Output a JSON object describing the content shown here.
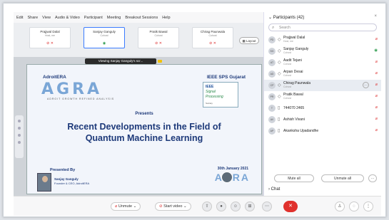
{
  "menubar": [
    "Edit",
    "Share",
    "View",
    "Audio & Video",
    "Participant",
    "Meeting",
    "Breakout Sessions",
    "Help"
  ],
  "strip": {
    "tiles": [
      {
        "name": "Prajjwal Dalal",
        "sub": "Host, me"
      },
      {
        "name": "Sanjay Ganguly",
        "sub": "Cohost"
      },
      {
        "name": "Pratik Bawal",
        "sub": "Cohost"
      },
      {
        "name": "Chirag Paunwala",
        "sub": "Cohost"
      }
    ],
    "layout_label": "Layout"
  },
  "stage": {
    "viewing": "Viewing Sanjay Ganguly's scr...",
    "slide": {
      "org_left": "AdroitERA",
      "agra": "AGRA",
      "agra_sub": "ADROIT GROWTH REFINED ANALYSIS",
      "org_right": "IEEE SPS Gujarat",
      "ieee_l1": "IEEE",
      "ieee_l2": "Signal",
      "ieee_l3": "Processing",
      "ieee_l4": "Society",
      "presents": "Presents",
      "title_line1": "Recent Developments in the Field of",
      "title_line2": "Quantum Machine Learning",
      "presented_by": "Presented By",
      "presenter_name": "Sanjay Ganguly",
      "presenter_role": "Founder & CEO, AdroitERA",
      "date": "30th January 2021",
      "agra_small": "AGRA"
    }
  },
  "panel": {
    "title": "Participants (42)",
    "search_placeholder": "Search",
    "participants": [
      {
        "initials": "PD",
        "name": "Prajjwal Dalal",
        "sub": "Host, me",
        "mic_on": false
      },
      {
        "initials": "SG",
        "name": "Sanjay Ganguly",
        "sub": "Cohost",
        "mic_on": true
      },
      {
        "initials": "AT",
        "name": "Aadit Tejani",
        "sub": "Cohost",
        "mic_on": false
      },
      {
        "initials": "AD",
        "name": "Arpan Desai",
        "sub": "Cohost",
        "mic_on": false
      },
      {
        "initials": "CP",
        "name": "Chirag Paunwala",
        "sub": "Cohost",
        "mic_on": false
      },
      {
        "initials": "PR",
        "name": "Pratik Bawal",
        "sub": "Cohost",
        "mic_on": false
      },
      {
        "initials": "T",
        "name": "744070 2465",
        "sub": "",
        "mic_on": false
      },
      {
        "initials": "AV",
        "name": "Ashish Vivani",
        "sub": "",
        "mic_on": false
      },
      {
        "initials": "AP",
        "name": "Akanksha Upadandhe",
        "sub": "",
        "mic_on": false
      }
    ],
    "mute_all": "Mute all",
    "unmute_all": "Unmute all",
    "chat": "Chat"
  },
  "controls": {
    "unmute": "Unmute",
    "start_video": "Start video"
  }
}
